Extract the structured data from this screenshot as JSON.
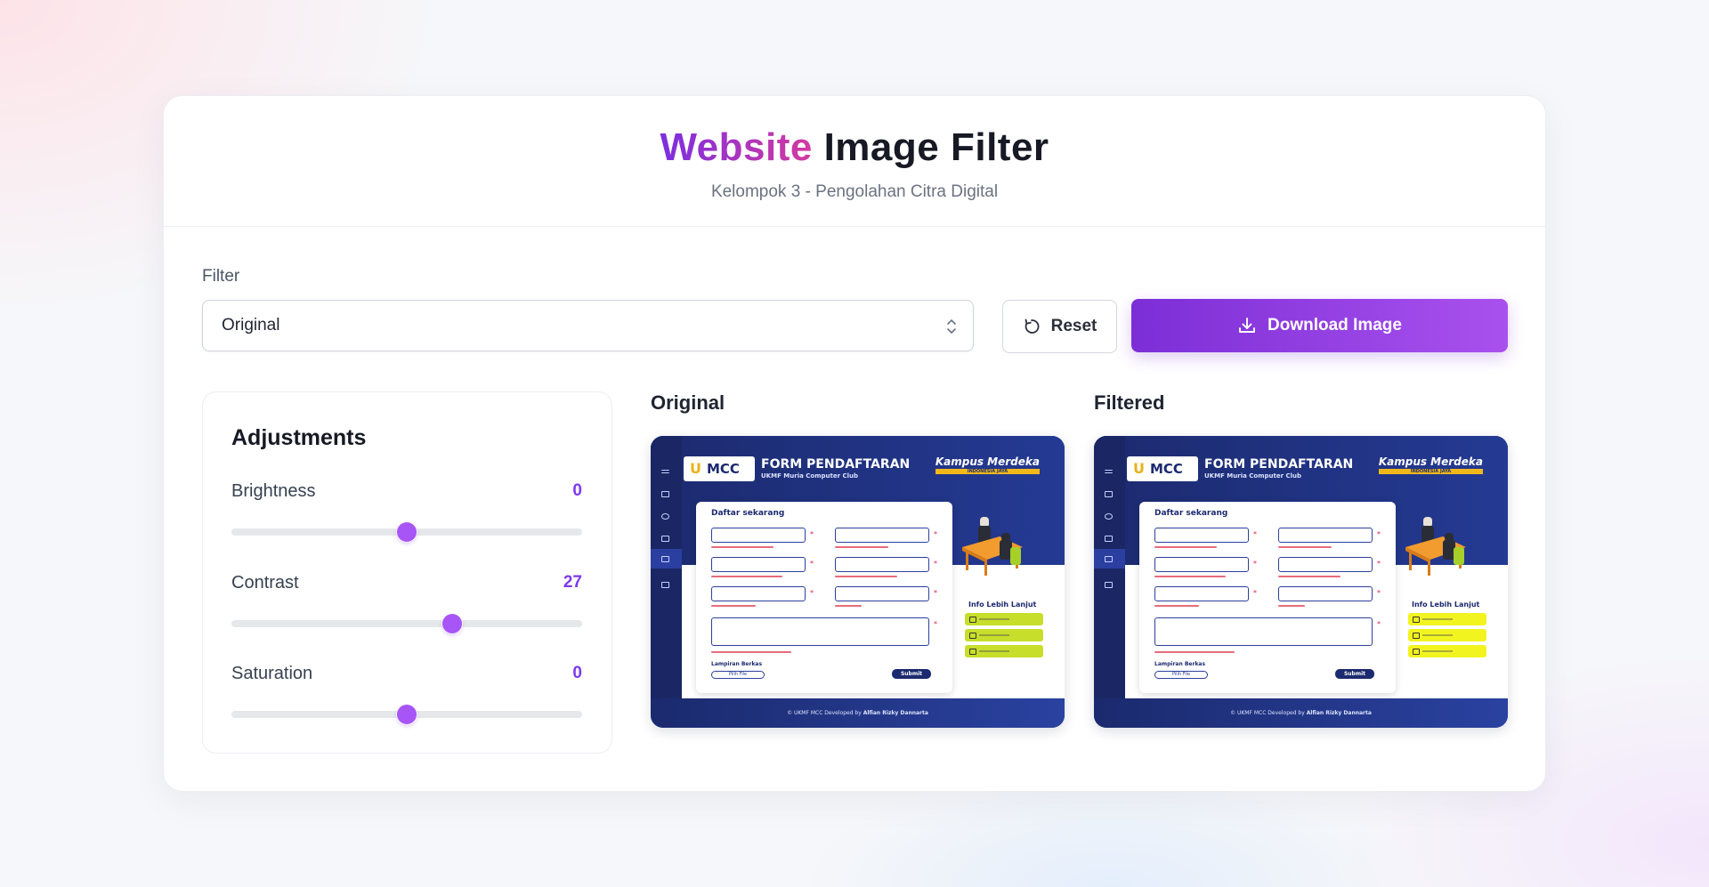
{
  "header": {
    "title_accent": "Website",
    "title_rest": "Image Filter",
    "subtitle": "Kelompok 3 - Pengolahan Citra Digital"
  },
  "filter": {
    "label": "Filter",
    "selected": "Original"
  },
  "actions": {
    "reset_label": "Reset",
    "download_label": "Download Image"
  },
  "adjustments": {
    "title": "Adjustments",
    "sliders": [
      {
        "label": "Brightness",
        "value": "0",
        "level": 0.5
      },
      {
        "label": "Contrast",
        "value": "27",
        "level": 0.63
      },
      {
        "label": "Saturation",
        "value": "0",
        "level": 0.5
      }
    ]
  },
  "previews": {
    "original_label": "Original",
    "filtered_label": "Filtered",
    "original_pill_color": "#c7df2a",
    "filtered_pill_color": "#f2f41f"
  },
  "mock_page": {
    "form_title": "FORM PENDAFTARAN",
    "form_subtitle": "UKMF Muria Computer Club",
    "logo_text": "MCC",
    "kampus_text": "Kampus Merdeka",
    "kampus_tag": "INDONESIA JAYA",
    "form_heading": "Daftar sekarang",
    "lampiran": "Lampiran Berkas",
    "upload": "Pilih File",
    "submit": "Submit",
    "info": "Info Lebih Lanjut",
    "footer_prefix": "© UKMF MCC Developed by",
    "footer_author": "Alfian Rizky Dannarta"
  },
  "colors": {
    "accent": "#7c3aed",
    "download_gradient_start": "#7c2ed6",
    "download_gradient_end": "#a951ee"
  }
}
